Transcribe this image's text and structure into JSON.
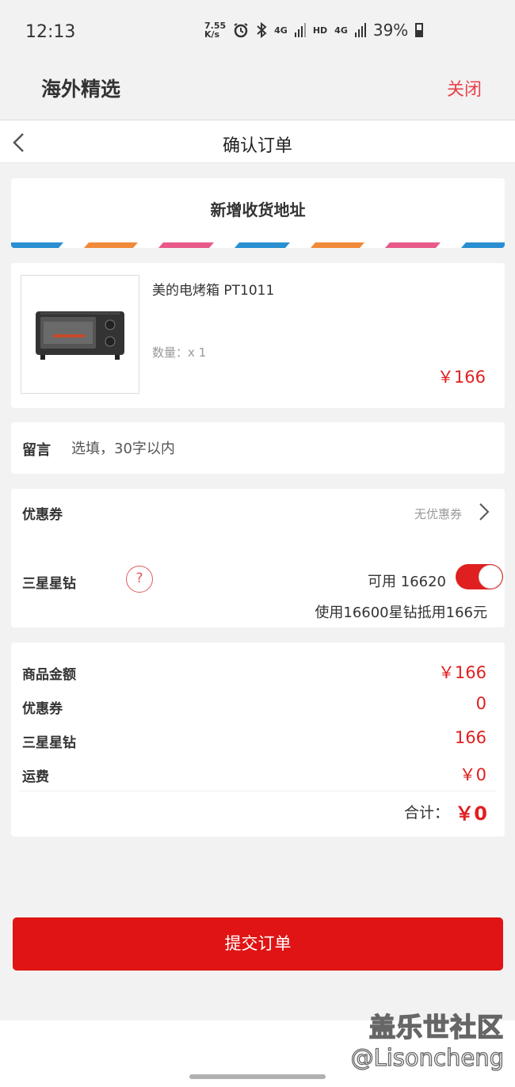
{
  "status_bar": {
    "time": "12:13",
    "speed": "7.55",
    "speed_unit": "K/s",
    "network_1": "4G",
    "hd": "HD",
    "network_2": "4G",
    "battery": "39%"
  },
  "app": {
    "title": "海外精选",
    "close_label": "关闭"
  },
  "nav": {
    "title": "确认订单",
    "back_icon": "chevron-left-icon"
  },
  "address": {
    "label": "新增收货地址",
    "stripe_colors": [
      "#2a8fd0",
      "#f08a3a",
      "#e85a8a"
    ]
  },
  "product": {
    "name": "美的电烤箱 PT1011",
    "quantity": "数量：x 1",
    "price": "￥166"
  },
  "message": {
    "label": "留言",
    "placeholder": "选填，30字以内"
  },
  "coupon": {
    "label": "优惠券",
    "value": "无优惠券"
  },
  "diamond": {
    "label": "三星星钻",
    "help": "?",
    "available": "可用 16620",
    "toggle_on": true,
    "use_text": "使用16600星钻抵用166元"
  },
  "summary": {
    "rows": [
      {
        "label": "商品金额",
        "value": "￥166"
      },
      {
        "label": "优惠券",
        "value": "0"
      },
      {
        "label": "三星星钻",
        "value": "166"
      },
      {
        "label": "运费",
        "value": "￥0"
      }
    ],
    "total_label": "合计：",
    "total_value": "￥0"
  },
  "submit_label": "提交订单",
  "watermark": {
    "line1": "盖乐世社区",
    "line2": "@Lisoncheng"
  },
  "colors": {
    "accent": "#e02020",
    "close": "#e8424a"
  }
}
